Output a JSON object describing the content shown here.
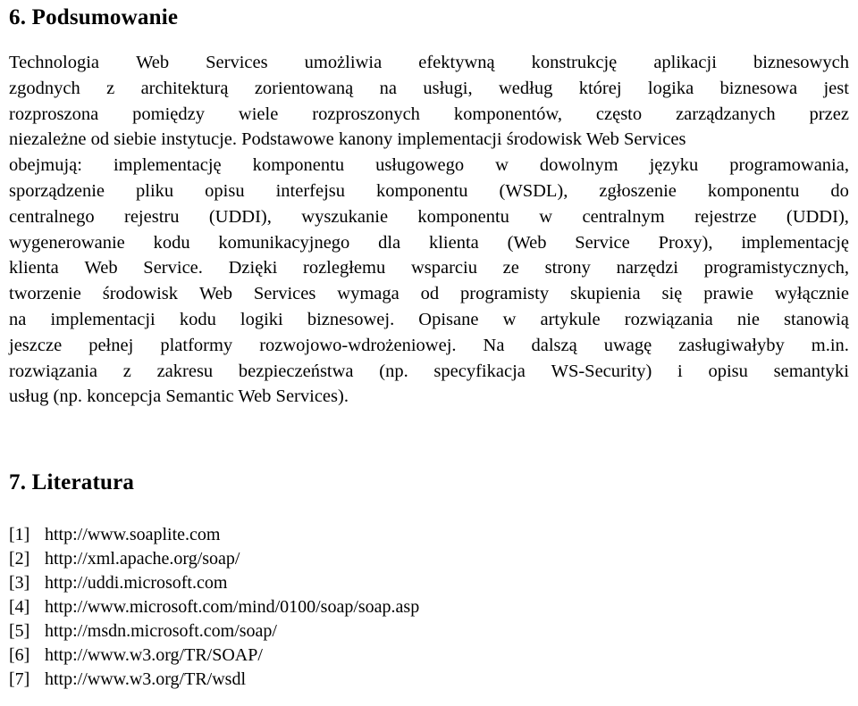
{
  "document": {
    "background_color": "#ffffff",
    "text_color": "#000000"
  },
  "summary_section": {
    "heading": "6. Podsumowanie",
    "paragraph_lines": [
      [
        "Technologia",
        "Web",
        "Services",
        "umożliwia",
        "efektywną",
        "konstrukcję",
        "aplikacji",
        "biznesowych"
      ],
      [
        "zgodnych",
        "z",
        "architekturą",
        "zorientowaną",
        "na",
        "usługi,",
        "według",
        "której",
        "logika",
        "biznesowa",
        "jest"
      ],
      [
        "rozproszona",
        "pomiędzy",
        "wiele",
        "rozproszonych",
        "komponentów,",
        "często",
        "zarządzanych",
        "przez"
      ],
      [
        "niezależne od siebie instytucje. Podstawowe kanony implementacji środowisk Web Services"
      ],
      [
        "obejmują:",
        "implementację",
        "komponentu",
        "usługowego",
        "w",
        "dowolnym",
        "języku",
        "programowania,"
      ],
      [
        "sporządzenie",
        "pliku",
        "opisu",
        "interfejsu",
        "komponentu",
        "(WSDL),",
        "zgłoszenie",
        "komponentu",
        "do"
      ],
      [
        "centralnego",
        "rejestru",
        "(UDDI),",
        "wyszukanie",
        "komponentu",
        "w",
        "centralnym",
        "rejestrze",
        "(UDDI),"
      ],
      [
        "wygenerowanie",
        "kodu",
        "komunikacyjnego",
        "dla",
        "klienta",
        "(Web",
        "Service",
        "Proxy),",
        "implementację"
      ],
      [
        "klienta",
        "Web",
        "Service.",
        "Dzięki",
        "rozległemu",
        "wsparciu",
        "ze",
        "strony",
        "narzędzi",
        "programistycznych,"
      ],
      [
        "tworzenie",
        "środowisk",
        "Web",
        "Services",
        "wymaga",
        "od",
        "programisty",
        "skupienia",
        "się",
        "prawie",
        "wyłącznie"
      ],
      [
        "na",
        "implementacji",
        "kodu",
        "logiki",
        "biznesowej.",
        "Opisane",
        "w",
        "artykule",
        "rozwiązania",
        "nie",
        "stanowią"
      ],
      [
        "jeszcze",
        "pełnej",
        "platformy",
        "rozwojowo-wdrożeniowej.",
        "Na",
        "dalszą",
        "uwagę",
        "zasługiwałyby",
        "m.in."
      ],
      [
        "rozwiązania",
        "z",
        "zakresu",
        "bezpieczeństwa",
        "(np.",
        "specyfikacja",
        "WS-Security)",
        "i",
        "opisu",
        "semantyki"
      ]
    ],
    "paragraph_last_line": "usług (np. koncepcja Semantic Web Services).",
    "paragraph_full_text": "Technologia Web Services umożliwia efektywną konstrukcję aplikacji biznesowych zgodnych z architekturą zorientowaną na usługi, według której logika biznesowa jest rozproszona pomiędzy wiele rozproszonych komponentów, często zarządzanych przez niezależne od siebie instytucje. Podstawowe kanony implementacji środowisk Web Services obejmują: implementację komponentu usługowego w dowolnym języku programowania, sporządzenie pliku opisu interfejsu komponentu (WSDL), zgłoszenie komponentu do centralnego rejestru (UDDI), wyszukanie komponentu w centralnym rejestrze (UDDI), wygenerowanie kodu komunikacyjnego dla klienta (Web Service Proxy), implementację klienta Web Service. Dzięki rozległemu wsparciu ze strony narzędzi programistycznych, tworzenie środowisk Web Services wymaga od programisty skupienia się prawie wyłącznie na implementacji kodu logiki biznesowej. Opisane w artykule rozwiązania nie stanowią jeszcze pełnej platformy rozwojowo-wdrożeniowej. Na dalszą uwagę zasługiwałyby m.in. rozwiązania z zakresu bezpieczeństwa (np. specyfikacja WS-Security) i opisu semantyki usług (np. koncepcja Semantic Web Services)."
  },
  "literature_section": {
    "heading": "7. Literatura",
    "references": [
      {
        "marker": "[1]",
        "url": "http://www.soaplite.com"
      },
      {
        "marker": "[2]",
        "url": "http://xml.apache.org/soap/"
      },
      {
        "marker": "[3]",
        "url": "http://uddi.microsoft.com"
      },
      {
        "marker": "[4]",
        "url": "http://www.microsoft.com/mind/0100/soap/soap.asp"
      },
      {
        "marker": "[5]",
        "url": "http://msdn.microsoft.com/soap/"
      },
      {
        "marker": "[6]",
        "url": "http://www.w3.org/TR/SOAP/"
      },
      {
        "marker": "[7]",
        "url": "http://www.w3.org/TR/wsdl"
      }
    ]
  }
}
